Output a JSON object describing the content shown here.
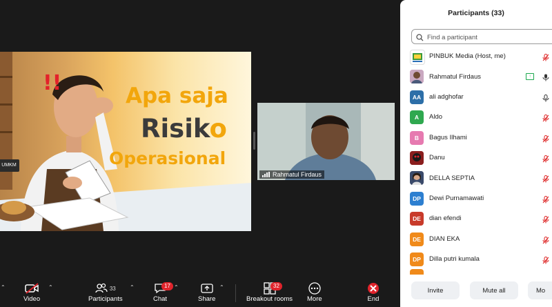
{
  "shared_slide": {
    "alert_text": "!!",
    "title_line1": "Apa saja",
    "title_line2_main": "Risik",
    "title_line2_accent": "o",
    "title_line3": "Operasional",
    "sign_text": "UMKM"
  },
  "video_tile": {
    "participant_name": "Rahmatul Firdaus"
  },
  "toolbar": {
    "video_label": "Video",
    "participants_label": "Participants",
    "participants_count": "33",
    "chat_label": "Chat",
    "chat_badge": "17",
    "share_label": "Share",
    "breakout_label": "Breakout rooms",
    "breakout_badge": "32",
    "more_label": "More",
    "end_label": "End"
  },
  "panel": {
    "title": "Participants (33)",
    "search_placeholder": "Find a participant",
    "participants": [
      {
        "name": "PINBUK Media (Host, me)",
        "initials": "",
        "avatar_color": "#ffffff",
        "mic": "muted"
      },
      {
        "name": "Rahmatul Firdaus",
        "initials": "",
        "avatar_color": "#c9a8c0",
        "mic": "on",
        "sharing": true
      },
      {
        "name": "ali adghofar",
        "initials": "AA",
        "avatar_color": "#2d6fa8",
        "mic": "on"
      },
      {
        "name": "Aldo",
        "initials": "A",
        "avatar_color": "#2fa84f",
        "mic": "muted"
      },
      {
        "name": "Bagus Ilhami",
        "initials": "B",
        "avatar_color": "#e67ab0",
        "mic": "muted"
      },
      {
        "name": "Danu",
        "initials": "",
        "avatar_color": "#b02a2a",
        "mic": "muted"
      },
      {
        "name": "DELLA SEPTIA",
        "initials": "",
        "avatar_color": "#6b5a7a",
        "mic": "muted"
      },
      {
        "name": "Dewi Purnamawati",
        "initials": "DP",
        "avatar_color": "#2d7fd0",
        "mic": "muted"
      },
      {
        "name": "dian efendi",
        "initials": "DE",
        "avatar_color": "#c83a2a",
        "mic": "muted"
      },
      {
        "name": "DIAN EKA",
        "initials": "DE",
        "avatar_color": "#f08a1a",
        "mic": "muted"
      },
      {
        "name": "Dilla putri kumala",
        "initials": "DP",
        "avatar_color": "#f08a1a",
        "mic": "muted"
      }
    ],
    "invite_label": "Invite",
    "mute_all_label": "Mute all",
    "more_label": "Mo"
  }
}
